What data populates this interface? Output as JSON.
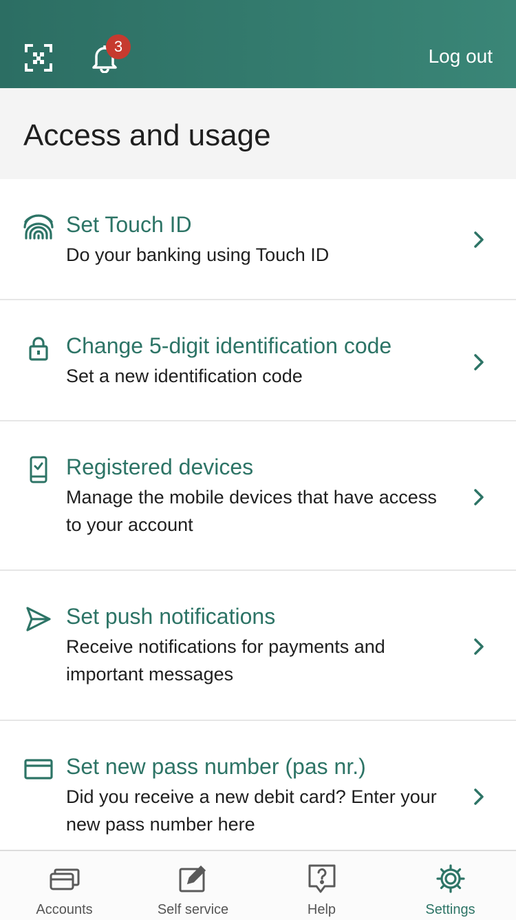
{
  "header": {
    "notification_count": "3",
    "logout_label": "Log out"
  },
  "section": {
    "title": "Access and usage"
  },
  "items": [
    {
      "icon": "fingerprint-icon",
      "title": "Set Touch ID",
      "subtitle": "Do your banking using Touch ID"
    },
    {
      "icon": "lock-icon",
      "title": "Change 5-digit identification code",
      "subtitle": "Set a new identification code"
    },
    {
      "icon": "phone-check-icon",
      "title": "Registered devices",
      "subtitle": "Manage the mobile devices that have access to your account"
    },
    {
      "icon": "send-icon",
      "title": "Set push notifications",
      "subtitle": "Receive notifications for payments and important messages"
    },
    {
      "icon": "card-icon",
      "title": "Set new pass number (pas nr.)",
      "subtitle": "Did you receive a new debit card? Enter your new pass number here"
    }
  ],
  "tabs": [
    {
      "icon": "cards-icon",
      "label": "Accounts"
    },
    {
      "icon": "edit-icon",
      "label": "Self service"
    },
    {
      "icon": "help-icon",
      "label": "Help"
    },
    {
      "icon": "settings-icon",
      "label": "Settings",
      "active": true
    }
  ],
  "colors": {
    "brand": "#2d7466",
    "header": "#2c6e63",
    "badge": "#c63a2f"
  }
}
